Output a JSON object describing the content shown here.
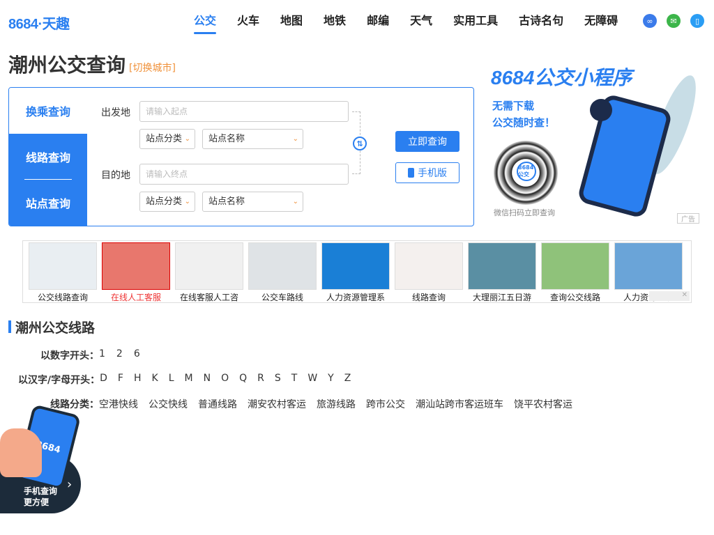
{
  "logo": {
    "text": "8684·天趣"
  },
  "nav": {
    "items": [
      "公交",
      "火车",
      "地图",
      "地铁",
      "邮编",
      "天气",
      "实用工具",
      "古诗名句",
      "无障碍"
    ],
    "icons": [
      {
        "name": "mini-program-icon",
        "color": "#3b7bea",
        "glyph": "∞"
      },
      {
        "name": "wechat-icon",
        "color": "#3cb54a",
        "glyph": "✉"
      },
      {
        "name": "mobile-icon",
        "color": "#2a9df4",
        "glyph": "▯"
      }
    ]
  },
  "title": "潮州公交查询",
  "switch_city": "[切换城市]",
  "query": {
    "tabs": [
      "换乘查询",
      "线路查询",
      "站点查询"
    ],
    "from_label": "出发地",
    "to_label": "目的地",
    "from_placeholder": "请输入起点",
    "to_placeholder": "请输入终点",
    "category_select": "站点分类",
    "name_select": "站点名称",
    "swap_glyph": "⇅",
    "submit": "立即查询",
    "mobile": "手机版"
  },
  "ad_right": {
    "title": "8684公交小程序",
    "sub1": "无需下载",
    "sub2": "公交随时查！",
    "qr_text": "8684公交",
    "caption": "微信扫码立即查询",
    "tag": "广告"
  },
  "strip": {
    "items": [
      {
        "label": "公交线路查询",
        "color": "#e9eef2"
      },
      {
        "label": "在线人工客服",
        "color": "#e8776d"
      },
      {
        "label": "在线客服人工咨",
        "color": "#f0f0f0"
      },
      {
        "label": "公交车路线",
        "color": "#dfe3e6"
      },
      {
        "label": "人力资源管理系",
        "color": "#1a7fd6"
      },
      {
        "label": "线路查询",
        "color": "#f4f0ee"
      },
      {
        "label": "大理丽江五日游",
        "color": "#5a8fa3"
      },
      {
        "label": "查询公交线路",
        "color": "#8fc27a"
      },
      {
        "label": "人力资源系统",
        "color": "#6aa4d8"
      }
    ],
    "close": "✕"
  },
  "lines": {
    "title": "潮州公交线路",
    "num_label": "以数字开头：",
    "nums": [
      "1",
      "2",
      "6"
    ],
    "letter_label": "以汉字/字母开头：",
    "letters": [
      "D",
      "F",
      "H",
      "K",
      "L",
      "M",
      "N",
      "O",
      "Q",
      "R",
      "S",
      "T",
      "W",
      "Y",
      "Z"
    ],
    "cat_label": "线路分类：",
    "cats": [
      "空港快线",
      "公交快线",
      "普通线路",
      "潮安农村客运",
      "旅游线路",
      "跨市公交",
      "潮汕站跨市客运班车",
      "饶平农村客运"
    ]
  },
  "float_promo": {
    "phone_text": "8684",
    "line1": "手机查询",
    "line2": "更方便",
    "arrow": "›"
  }
}
